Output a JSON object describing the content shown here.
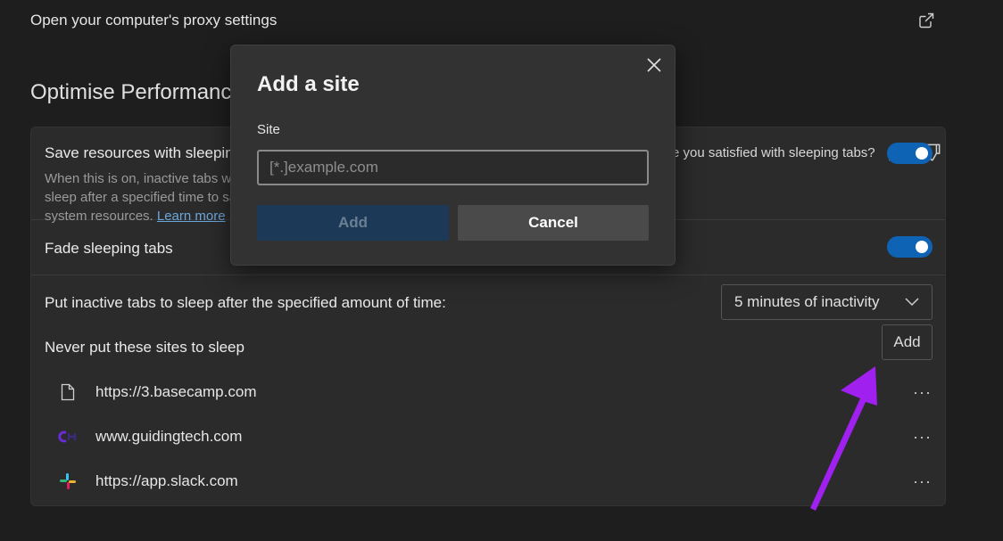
{
  "proxy": {
    "label": "Open your computer's proxy settings",
    "icon": "external-link-icon"
  },
  "section": {
    "title": "Optimise Performance"
  },
  "sleeping_tabs": {
    "title": "Save resources with sleeping tabs",
    "description": "When this is on, inactive tabs will go to sleep after a specified time to save system resources.",
    "learn_more": "Learn more",
    "feedback_question": "Are you satisfied with sleeping tabs?",
    "toggle_on": true
  },
  "fade": {
    "title": "Fade sleeping tabs",
    "toggle_on": true
  },
  "inactivity": {
    "label": "Put inactive tabs to sleep after the specified amount of time:",
    "selected": "5 minutes of inactivity"
  },
  "never_sleep": {
    "label": "Never put these sites to sleep",
    "add_label": "Add",
    "more_label": "···",
    "sites": [
      {
        "url": "https://3.basecamp.com",
        "icon": "page-icon"
      },
      {
        "url": "www.guidingtech.com",
        "icon": "guidingtech-icon"
      },
      {
        "url": "https://app.slack.com",
        "icon": "slack-icon"
      }
    ]
  },
  "dialog": {
    "title": "Add a site",
    "field_label": "Site",
    "placeholder": "[*.]example.com",
    "value": "",
    "add_label": "Add",
    "cancel_label": "Cancel"
  },
  "colors": {
    "accent": "#0f63b5",
    "arrow": "#a020f0",
    "background": "#1e1e1e",
    "card": "#2b2b2b",
    "dialog": "#323232"
  }
}
